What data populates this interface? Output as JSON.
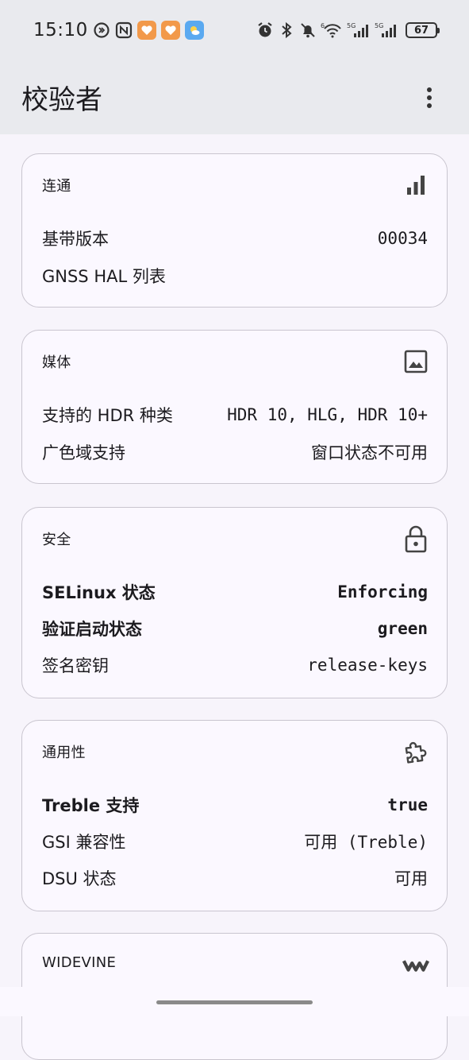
{
  "status_bar": {
    "time": "15:10",
    "battery": "67",
    "network_1": "5G",
    "network_2": "5G"
  },
  "app_bar": {
    "title": "校验者"
  },
  "cards": {
    "connectivity": {
      "title": "连通",
      "icon": "signal-bars-icon",
      "rows": [
        {
          "label": "基带版本",
          "value": "00034"
        },
        {
          "label": "GNSS HAL 列表",
          "value": ""
        }
      ]
    },
    "media": {
      "title": "媒体",
      "icon": "image-icon",
      "rows": [
        {
          "label": "支持的 HDR 种类",
          "value": "HDR 10, HLG, HDR 10+"
        },
        {
          "label": "广色域支持",
          "value": "窗口状态不可用"
        }
      ]
    },
    "security": {
      "title": "安全",
      "icon": "lock-icon",
      "rows": [
        {
          "label": "SELinux 状态",
          "value": "Enforcing"
        },
        {
          "label": "验证启动状态",
          "value": "green"
        },
        {
          "label": "签名密钥",
          "value": "release-keys"
        }
      ]
    },
    "generality": {
      "title": "通用性",
      "icon": "puzzle-icon",
      "rows": [
        {
          "label": "Treble 支持",
          "value": "true"
        },
        {
          "label": "GSI 兼容性",
          "value": "可用 (Treble)"
        },
        {
          "label": "DSU 状态",
          "value": "可用"
        }
      ]
    },
    "widevine": {
      "title": "WIDEVINE",
      "icon": "widevine-logo-icon"
    }
  },
  "colors": {
    "background": "#f7f4fb",
    "app_bar": "#e9eaee",
    "card_border": "#c9c5cf",
    "text": "#1c1b1f"
  }
}
